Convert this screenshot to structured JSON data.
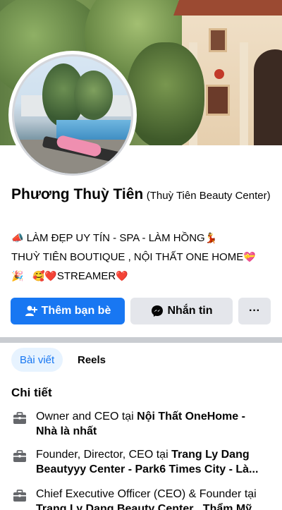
{
  "profile": {
    "name": "Phương Thuỳ Tiên",
    "subname": "(Thuỳ Tiên Beauty Center)",
    "bio_line1": "LÀM ĐẸP UY TÍN - SPA - LÀM HỒNG",
    "bio_line2": "THUỲ TIÊN BOUTIQUE , NỘI THẤT ONE HOME",
    "bio_line3": "STREAMER",
    "bio_emojis": {
      "megaphone": "📣",
      "dancer": "💃",
      "heart_gift": "💝",
      "party": "🎉",
      "smiling_hearts": "🥰",
      "red_heart": "❤️"
    }
  },
  "actions": {
    "add_friend": "Thêm bạn bè",
    "message": "Nhắn tin",
    "more": "···"
  },
  "tabs": {
    "posts": "Bài viết",
    "reels": "Reels"
  },
  "details": {
    "title": "Chi tiết",
    "items": [
      {
        "prefix": "Owner and CEO tại ",
        "bold": "Nội Thất OneHome - Nhà là nhất"
      },
      {
        "prefix": "Founder, Director, CEO tại ",
        "bold": "Trang Ly Dang Beautyyy Center - Park6 Times City - Là..."
      },
      {
        "prefix": "Chief Executive Officer (CEO) & Founder tại ",
        "bold": "Trang Ly Dang Beauty Center , Thẩm Mỹ"
      }
    ],
    "icon": "briefcase-icon"
  },
  "colors": {
    "primary": "#1877f2",
    "secondary_button": "#e4e6eb",
    "tab_active_bg": "#e7f3ff"
  }
}
